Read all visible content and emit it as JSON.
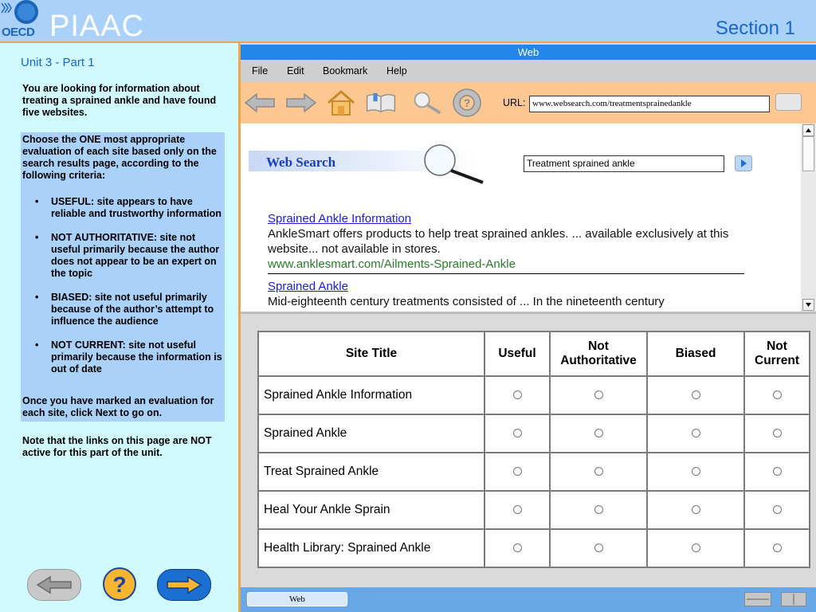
{
  "header": {
    "oecd": "OECD",
    "brand": "PIAAC",
    "section": "Section 1"
  },
  "left": {
    "unit_title": "Unit 3 - Part 1",
    "intro": "You are looking for information about treating a sprained ankle and have found five websites.",
    "instructions_head": "Choose the ONE most appropriate evaluation of each site based only on the search results page, according to the following criteria:",
    "criteria": [
      "USEFUL: site appears to have reliable and trustworthy information",
      "NOT AUTHORITATIVE:  site not useful primarily because the author does not appear to be an expert on the topic",
      "BIASED:  site not useful primarily because of the author’s attempt to influence the audience",
      "NOT CURRENT: site not useful primarily because the information is out of date"
    ],
    "instructions_foot": "Once you have marked an evaluation for each site, click Next to go on.",
    "note": "Note that the links on this page are NOT active for this part of the unit."
  },
  "nav": {
    "back_icon": "arrow-left-icon",
    "help_icon": "question-icon",
    "next_icon": "arrow-right-icon"
  },
  "browser": {
    "title": "Web",
    "menu": [
      "File",
      "Edit",
      "Bookmark",
      "Help"
    ],
    "url_label": "URL:",
    "url_value": "www.websearch.com/treatmentsprainedankle",
    "search_logo": "Web Search",
    "search_value": "Treatment sprained ankle",
    "results": [
      {
        "title": "Sprained Ankle Information",
        "desc": "AnkleSmart offers products to help treat sprained ankles. ... available exclusively at this website... not available in stores.",
        "url": "www.anklesmart.com/Ailments-Sprained-Ankle"
      },
      {
        "title": "Sprained Ankle",
        "desc": "Mid-eighteenth century treatments consisted of ... In the nineteenth century"
      }
    ],
    "status_tab": "Web"
  },
  "table": {
    "headers": [
      "Site Title",
      "Useful",
      "Not Authoritative",
      "Biased",
      "Not Current"
    ],
    "rows": [
      "Sprained Ankle Information",
      "Sprained Ankle",
      "Treat Sprained Ankle",
      "Heal Your Ankle Sprain",
      "Health Library: Sprained Ankle"
    ]
  },
  "colors": {
    "header_bg": "#a9d1fa",
    "accent_orange": "#f0a544",
    "panel_bg": "#d0faff",
    "title_blue": "#2286e8",
    "link_blue": "#1a1ae0",
    "url_green": "#2a7a2a"
  }
}
